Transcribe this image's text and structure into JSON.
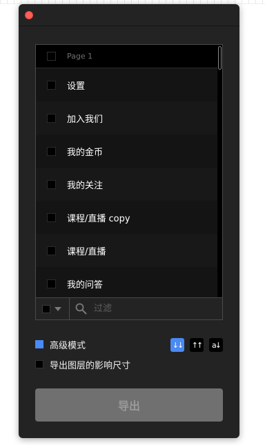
{
  "list": {
    "page_header": "Page 1",
    "items": [
      {
        "label": "设置"
      },
      {
        "label": "加入我们"
      },
      {
        "label": "我的金币"
      },
      {
        "label": "我的关注"
      },
      {
        "label": "课程/直播 copy"
      },
      {
        "label": "课程/直播"
      },
      {
        "label": "我的问答"
      }
    ]
  },
  "filter": {
    "placeholder": "过滤",
    "value": ""
  },
  "options": {
    "advanced_mode": {
      "label": "高级模式",
      "checked": true
    },
    "export_layer_influence": {
      "label": "导出图层的影响尺寸",
      "checked": false
    }
  },
  "sort": {
    "buttons": [
      {
        "icon": "sort-descending-icon",
        "glyph": "↓↓",
        "active": true
      },
      {
        "icon": "sort-ascending-icon",
        "glyph": "↑↑",
        "active": false
      },
      {
        "icon": "sort-alpha-icon",
        "glyph": "a↓",
        "active": false
      }
    ]
  },
  "export": {
    "label": "导出"
  },
  "colors": {
    "window_bg": "#232323",
    "list_bg": "#111111",
    "accent": "#4a8af4",
    "close": "#fc5f57",
    "export_button": "#707070"
  }
}
